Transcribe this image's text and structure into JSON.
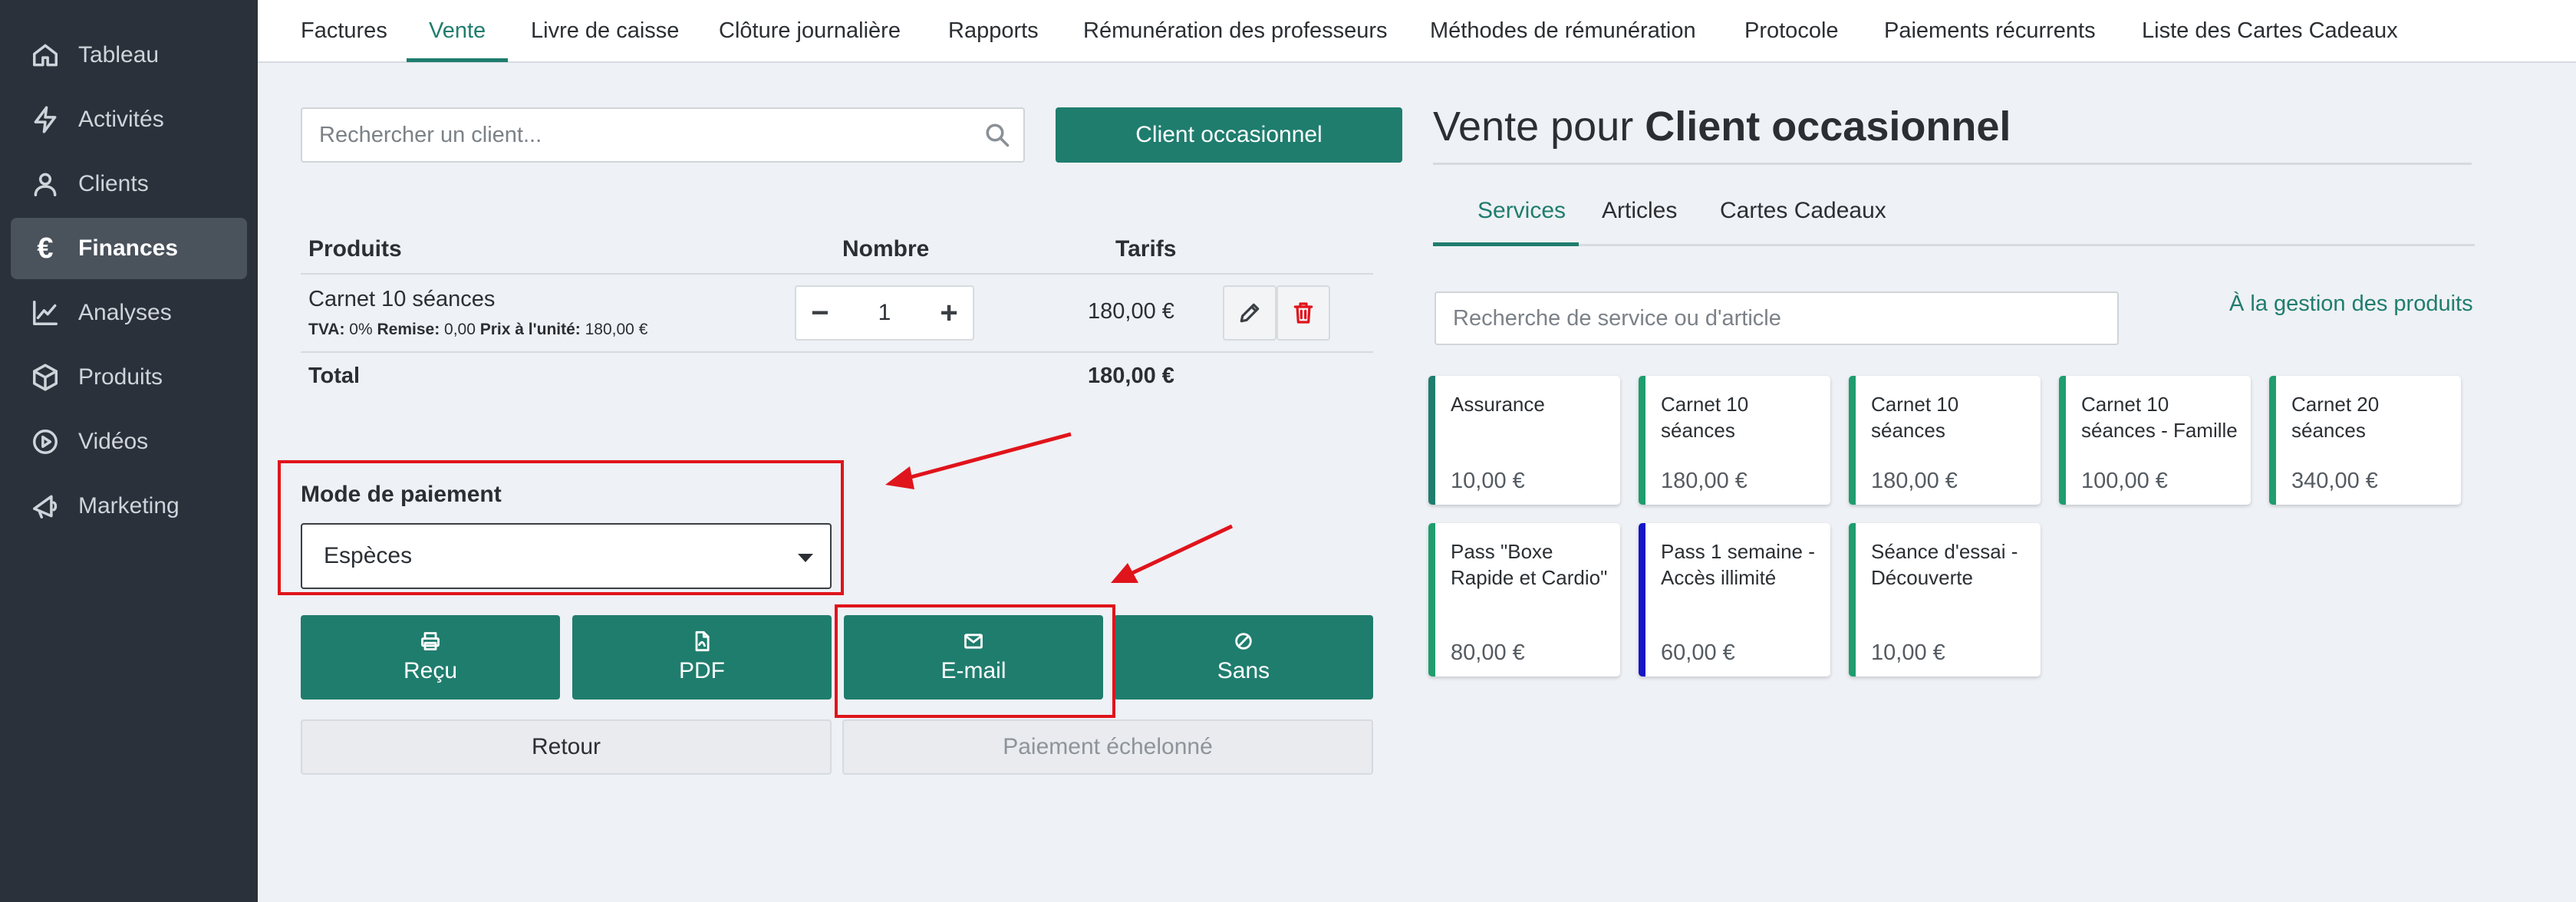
{
  "sidebar": {
    "items": [
      {
        "label": "Tableau",
        "icon": "home-icon"
      },
      {
        "label": "Activités",
        "icon": "bolt-icon"
      },
      {
        "label": "Clients",
        "icon": "user-icon"
      },
      {
        "label": "Finances",
        "icon": "euro-icon",
        "active": true
      },
      {
        "label": "Analyses",
        "icon": "chart-line-icon"
      },
      {
        "label": "Produits",
        "icon": "box-icon"
      },
      {
        "label": "Vidéos",
        "icon": "play-circle-icon"
      },
      {
        "label": "Marketing",
        "icon": "megaphone-icon"
      }
    ]
  },
  "top_tabs": [
    "Factures",
    "Vente",
    "Livre de caisse",
    "Clôture journalière",
    "Rapports",
    "Rémunération des professeurs",
    "Méthodes de rémunération",
    "Protocole",
    "Paiements récurrents",
    "Liste des Cartes Cadeaux"
  ],
  "active_top_tab": "Vente",
  "client_search": {
    "placeholder": "Rechercher un client..."
  },
  "occasional_button": "Client occasionnel",
  "cart": {
    "headers": {
      "product": "Produits",
      "quantity": "Nombre",
      "price": "Tarifs"
    },
    "rows": [
      {
        "name": "Carnet 10 séances",
        "tva_label": "TVA:",
        "tva_value": "0%",
        "discount_label": "Remise:",
        "discount_value": "0,00",
        "unit_label": "Prix à l'unité:",
        "unit_value": "180,00 €",
        "quantity": "1",
        "price": "180,00 €"
      }
    ],
    "total_label": "Total",
    "total_value": "180,00 €"
  },
  "payment": {
    "label": "Mode de paiement",
    "selected": "Espèces"
  },
  "actions": {
    "receipt": "Reçu",
    "pdf": "PDF",
    "email": "E-mail",
    "none": "Sans",
    "back": "Retour",
    "installment": "Paiement échelonné"
  },
  "sale": {
    "title_prefix": "Vente pour",
    "title_client": "Client occasionnel"
  },
  "product_tabs": [
    "Services",
    "Articles",
    "Cartes Cadeaux"
  ],
  "active_product_tab": "Services",
  "product_search": {
    "placeholder": "Recherche de service ou d'article"
  },
  "manage_link": "À la gestion des produits",
  "products": [
    {
      "name": "Assurance",
      "price": "10,00 €",
      "color": "#1f7d6e"
    },
    {
      "name": "Carnet 10 séances",
      "price": "180,00 €",
      "color": "#1f9d6e"
    },
    {
      "name": "Carnet 10 séances",
      "price": "180,00 €",
      "color": "#1f9d6e"
    },
    {
      "name": "Carnet 10 séances - Famille",
      "price": "100,00 €",
      "color": "#1f9d6e"
    },
    {
      "name": "Carnet 20 séances",
      "price": "340,00 €",
      "color": "#1f9d6e"
    },
    {
      "name": "Pass \"Boxe Rapide et Cardio\"",
      "price": "80,00 €",
      "color": "#1f9d6e"
    },
    {
      "name": "Pass 1 semaine - Accès illimité",
      "price": "60,00 €",
      "color": "#1616c8"
    },
    {
      "name": "Séance d'essai - Découverte",
      "price": "10,00 €",
      "color": "#1f9d6e"
    }
  ],
  "colors": {
    "accent": "#1f7d6e",
    "sidebar": "#2b313a",
    "annotation_red": "#e0141b"
  }
}
